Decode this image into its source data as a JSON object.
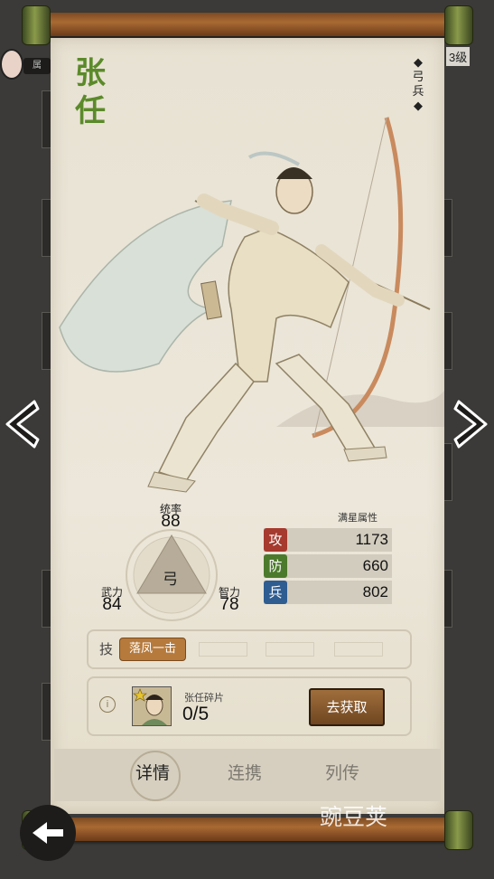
{
  "hero": {
    "name_char1": "张",
    "name_char2": "任",
    "class_char1": "弓",
    "class_char2": "兵"
  },
  "background": {
    "tag": "属",
    "level": "3级"
  },
  "stats": {
    "leadership_label": "统率",
    "leadership": "88",
    "force_label": "武力",
    "force": "84",
    "intellect_label": "智力",
    "intellect": "78",
    "troop_type": "弓"
  },
  "full_star": {
    "title": "满星属性",
    "attack_label": "攻",
    "attack": "1173",
    "defense_label": "防",
    "defense": "660",
    "troops_label": "兵",
    "troops": "802"
  },
  "skills": {
    "label": "技",
    "skill1": "落凤一击"
  },
  "shard": {
    "name": "张任碎片",
    "count": "0/5",
    "button": "去获取",
    "info": "i"
  },
  "tabs": {
    "details": "详情",
    "combo": "连携",
    "biography": "列传"
  },
  "watermark": "豌豆荚",
  "colors": {
    "attack": "#a63a2e",
    "defense": "#4c7a2c",
    "troops": "#2f5d91",
    "name": "#5b8a2a"
  }
}
